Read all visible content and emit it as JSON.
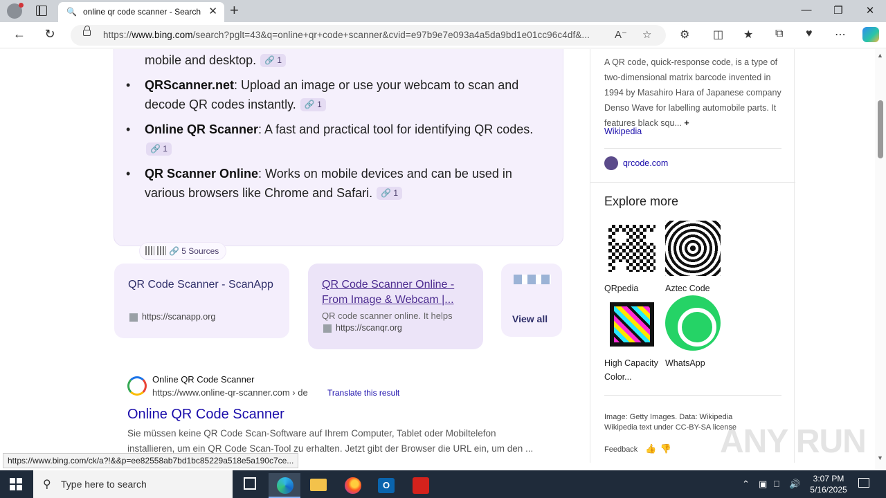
{
  "browser": {
    "tab_title": "online qr code scanner - Search",
    "url_host_prefix": "https://",
    "url_host": "www.bing.com",
    "url_rest": "/search?pglt=43&q=online+qr+code+scanner&cvid=e97b9e7e093a4a5da9bd1e01cc96c4df&...",
    "status_url": "https://www.bing.com/ck/a?!&&p=ee82558ab7bd1bc85229a518e5a190c7ce..."
  },
  "chat": {
    "bullets": [
      {
        "name": "",
        "text": "mobile and desktop.",
        "cite": "1"
      },
      {
        "name": "QRScanner.net",
        "text": ": Upload an image or use your webcam to scan and decode QR codes instantly.",
        "cite": "1"
      },
      {
        "name": "Online QR Scanner",
        "text": ": A fast and practical tool for identifying QR codes.",
        "cite": "1"
      },
      {
        "name": "QR Scanner Online",
        "text": ": Works on mobile devices and can be used in various browsers like Chrome and Safari.",
        "cite": "1"
      }
    ],
    "sources_label": "5 Sources"
  },
  "cards": [
    {
      "title": "QR Code Scanner - ScanApp",
      "snippet": "",
      "url": "https://scanapp.org"
    },
    {
      "title": "QR Code Scanner Online - From Image & Webcam |...",
      "snippet": "QR code scanner online. It helps",
      "url": "https://scanqr.org"
    },
    {
      "title": "View all"
    }
  ],
  "result": {
    "site_name": "Online QR Code Scanner",
    "cite": "https://www.online-qr-scanner.com › de",
    "translate": "Translate this result",
    "title": "Online QR Code Scanner",
    "snippet": "Sie müssen keine QR Code Scan-Software auf Ihrem Computer, Tablet oder Mobiltelefon installieren, um ein QR Code Scan-Tool zu erhalten. Jetzt gibt der Browser die URL ein, um den ..."
  },
  "right_panel": {
    "description": "A QR code, quick-response code, is a type of two-dimensional matrix barcode invented in 1994 by Masahiro Hara of Japanese company Denso Wave for labelling automobile parts. It features black squ...",
    "more": "+",
    "wiki_link": "Wikipedia",
    "site_link": "qrcode.com",
    "explore_title": "Explore more",
    "explore_items": [
      "QRpedia",
      "Aztec Code",
      "High Capacity Color...",
      "WhatsApp"
    ],
    "credit_line1": "Image: Getty Images. Data: Wikipedia",
    "credit_line2": "Wikipedia text under CC-BY-SA license",
    "feedback": "Feedback"
  },
  "watermark": "ANY RUN",
  "taskbar": {
    "search_placeholder": "Type here to search",
    "time": "3:07 PM",
    "date": "5/16/2025"
  }
}
